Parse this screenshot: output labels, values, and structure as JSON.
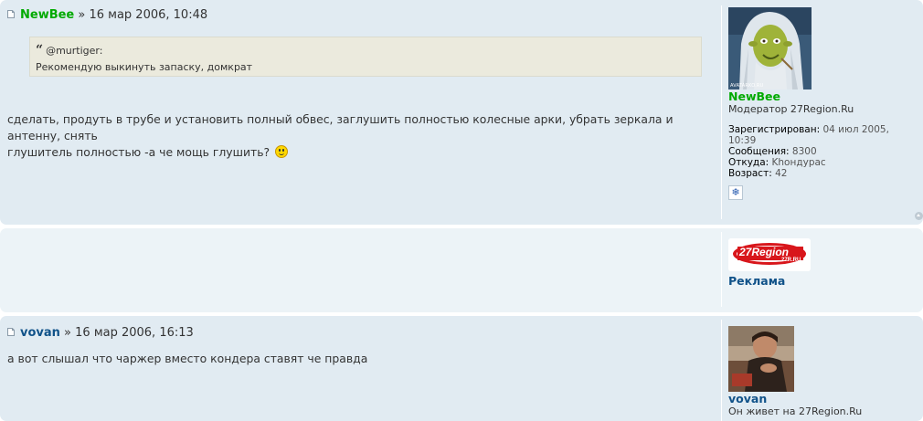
{
  "posts": [
    {
      "author": "NewBee",
      "separator": " » ",
      "date": "16 мар 2006, 10:48",
      "quote": {
        "cite": "@murtiger:",
        "text": "Рекомендую выкинуть запаску, домкрат"
      },
      "content_line1": "сделать, продуть в трубе и установить полный обвес, заглушить полностью колесные арки, убрать зеркала и антенну, снять",
      "content_line2": "глушитель полностью -а че мощь глушить?",
      "profile": {
        "name": "NewBee",
        "rank": "Модератор 27Region.Ru",
        "registered_label": "Зарегистрирован:",
        "registered_value": "04 июл 2005, 10:39",
        "messages_label": "Сообщения:",
        "messages_value": "8300",
        "from_label": "Откуда:",
        "from_value": "Khондурас",
        "age_label": "Возраст:",
        "age_value": "42",
        "contact_icon": "snowflake-icon"
      }
    },
    {
      "author": "vovan",
      "separator": " » ",
      "date": "16 мар 2006, 16:13",
      "content": "а вот слышал что чаржер вместо кондера ставят че правда",
      "profile": {
        "name": "vovan",
        "rank": "Он живет на 27Region.Ru"
      }
    }
  ],
  "ad": {
    "logo_text": "27Region",
    "logo_sub": "27R.RU",
    "label": "Реклама"
  },
  "avatar_watermark": "AVATARKO.RU",
  "colors": {
    "post_bg1": "#e1ebf2",
    "post_bg2": "#ecf3f7",
    "moderator_name": "#00aa00",
    "user_name": "#105289",
    "quote_bg": "#ebeadd",
    "logo_red": "#d8161b"
  }
}
